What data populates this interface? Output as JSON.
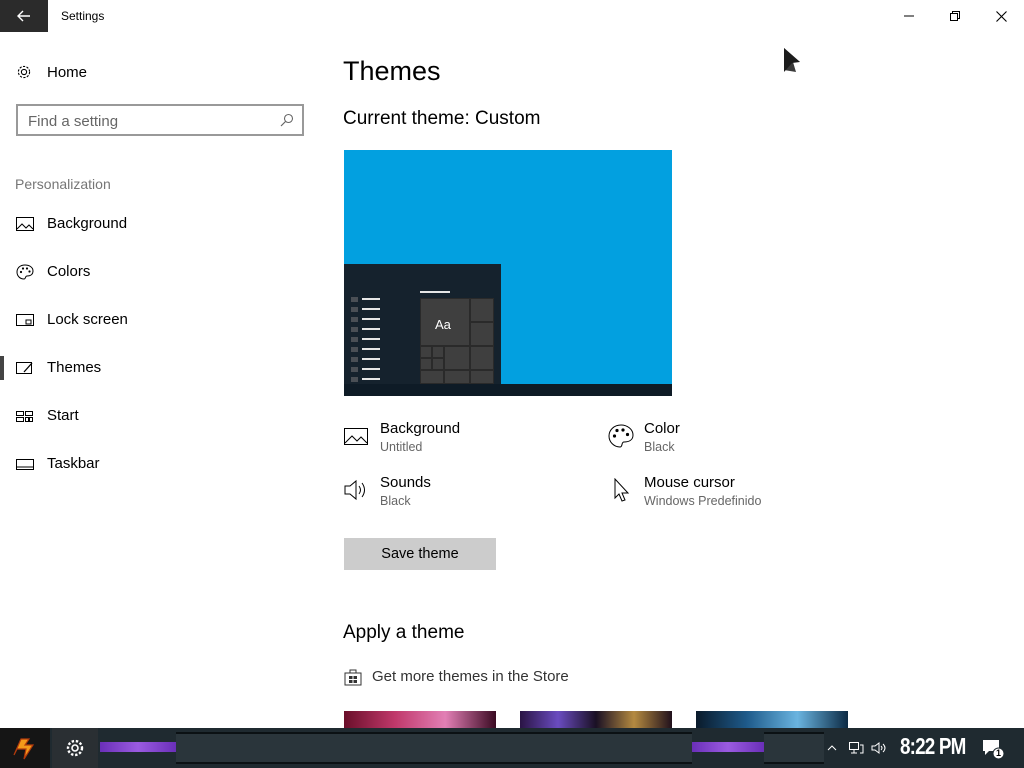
{
  "window": {
    "title": "Settings",
    "controls": {
      "minimize": "minimize-icon",
      "maximize": "restore-icon",
      "close": "close-icon"
    }
  },
  "sidebar": {
    "home_label": "Home",
    "search_placeholder": "Find a setting",
    "section_label": "Personalization",
    "items": [
      {
        "label": "Background",
        "icon": "image-icon"
      },
      {
        "label": "Colors",
        "icon": "palette-icon"
      },
      {
        "label": "Lock screen",
        "icon": "lock-screen-icon"
      },
      {
        "label": "Themes",
        "icon": "themes-icon",
        "selected": true
      },
      {
        "label": "Start",
        "icon": "start-icon"
      },
      {
        "label": "Taskbar",
        "icon": "taskbar-icon"
      }
    ]
  },
  "main": {
    "title": "Themes",
    "current_theme": "Current theme: Custom",
    "preview_sample": "Aa",
    "settings": [
      {
        "name": "Background",
        "value": "Untitled",
        "icon": "image-icon"
      },
      {
        "name": "Color",
        "value": "Black",
        "icon": "palette-icon"
      },
      {
        "name": "Sounds",
        "value": "Black",
        "icon": "speaker-icon"
      },
      {
        "name": "Mouse cursor",
        "value": "Windows Predefinido",
        "icon": "cursor-icon"
      }
    ],
    "save_button": "Save theme",
    "apply_title": "Apply a theme",
    "store_link": "Get more themes in the Store"
  },
  "taskbar": {
    "time": "8:22 PM",
    "notification_count": "1"
  },
  "colors": {
    "accent_preview": "#02a0e0",
    "taskbar_bar": "#8a4fd8",
    "button_gray": "#cccccc"
  }
}
